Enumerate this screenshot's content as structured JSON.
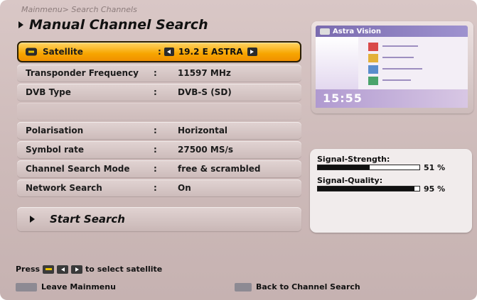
{
  "breadcrumb": "Mainmenu> Search Channels",
  "title": "Manual Channel Search",
  "rows": [
    {
      "label": "Satellite",
      "colon": ":",
      "value": "19.2 E ASTRA"
    },
    {
      "label": "Transponder Frequency",
      "colon": ":",
      "value": "11597 MHz"
    },
    {
      "label": "DVB Type",
      "colon": ":",
      "value": "DVB-S (SD)"
    },
    {
      "label": "",
      "colon": "",
      "value": ""
    },
    {
      "label": "Polarisation",
      "colon": ":",
      "value": "Horizontal"
    },
    {
      "label": "Symbol rate",
      "colon": ":",
      "value": "27500 MS/s"
    },
    {
      "label": "Channel Search Mode",
      "colon": ":",
      "value": "free & scrambled"
    },
    {
      "label": "Network Search",
      "colon": ":",
      "value": "On"
    }
  ],
  "start_search": "Start Search",
  "preview": {
    "channel": "Astra Vision",
    "time": "15:55"
  },
  "signal": {
    "strength_label": "Signal-Strength:",
    "strength_pct": 51,
    "strength_text": "51 %",
    "quality_label": "Signal-Quality:",
    "quality_pct": 95,
    "quality_text": "95 %"
  },
  "help": {
    "prefix": "Press",
    "suffix": "to select satellite",
    "leave": "Leave Mainmenu",
    "back": "Back to Channel Search"
  },
  "colors": {
    "highlight": "#f7a500",
    "panel": "#cdbab9"
  }
}
